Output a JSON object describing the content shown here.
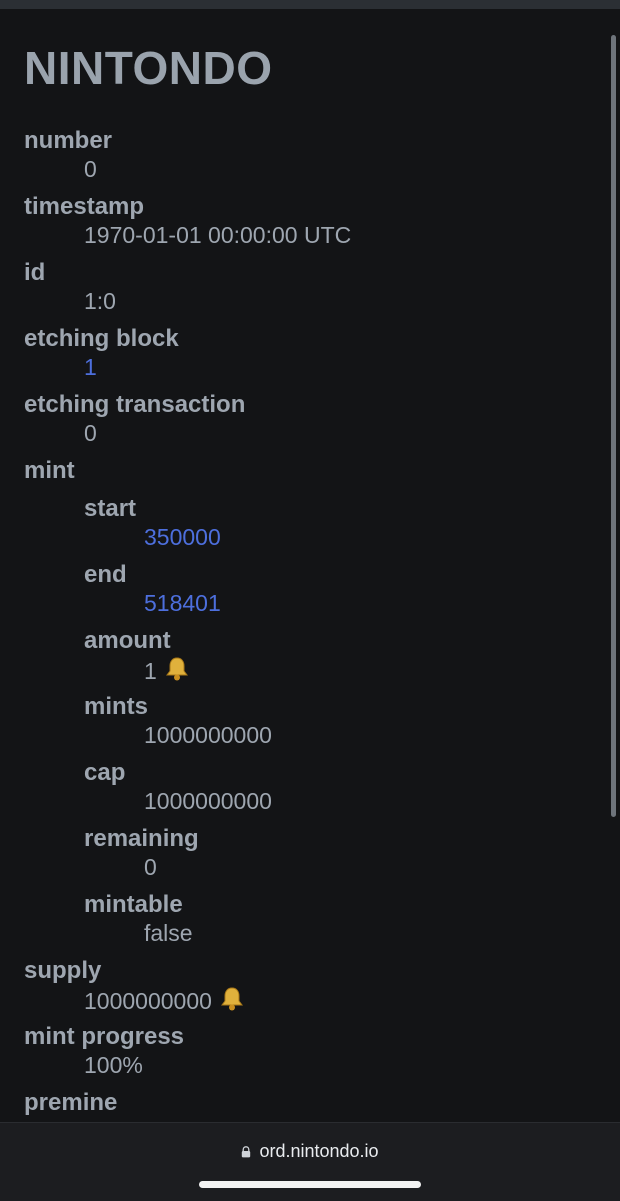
{
  "page": {
    "title": "NINTONDO"
  },
  "fields": {
    "number": {
      "label": "number",
      "value": "0"
    },
    "timestamp": {
      "label": "timestamp",
      "value": "1970-01-01 00:00:00 UTC"
    },
    "id": {
      "label": "id",
      "value": "1:0"
    },
    "etching_block": {
      "label": "etching block",
      "value": "1"
    },
    "etching_transaction": {
      "label": "etching transaction",
      "value": "0"
    },
    "mint": {
      "label": "mint",
      "start": {
        "label": "start",
        "value": "350000"
      },
      "end": {
        "label": "end",
        "value": "518401"
      },
      "amount": {
        "label": "amount",
        "value": "1"
      },
      "mints": {
        "label": "mints",
        "value": "1000000000"
      },
      "cap": {
        "label": "cap",
        "value": "1000000000"
      },
      "remaining": {
        "label": "remaining",
        "value": "0"
      },
      "mintable": {
        "label": "mintable",
        "value": "false"
      }
    },
    "supply": {
      "label": "supply",
      "value": "1000000000"
    },
    "mint_progress": {
      "label": "mint progress",
      "value": "100%"
    },
    "premine": {
      "label": "premine"
    }
  },
  "browser": {
    "url": "ord.nintondo.io"
  },
  "icons": {
    "rune_symbol": "bell-icon",
    "secure": "lock-icon"
  },
  "colors": {
    "background": "#131416",
    "text": "#9ea6b0",
    "link": "#4d6fdd"
  }
}
